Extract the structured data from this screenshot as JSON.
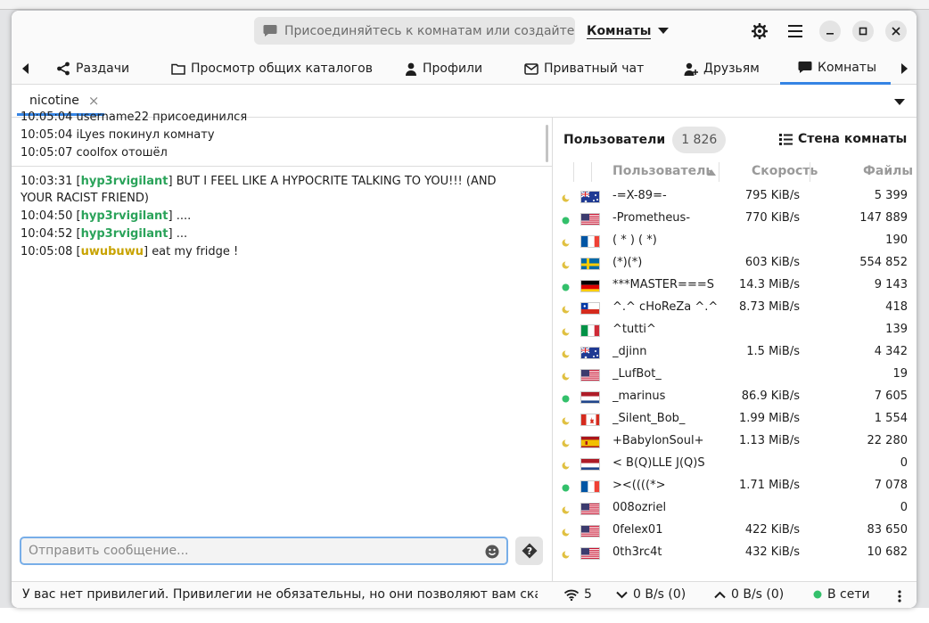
{
  "header": {
    "search_placeholder": "Присоединяйтесь к комнатам или создайте ...",
    "mode_label": "Комнаты"
  },
  "tabs": [
    {
      "label": "Раздачи",
      "icon": "share-icon"
    },
    {
      "label": "Просмотр общих каталогов",
      "icon": "folder-icon"
    },
    {
      "label": "Профили",
      "icon": "user-icon"
    },
    {
      "label": "Приватный чат",
      "icon": "mail-icon"
    },
    {
      "label": "Друзьям",
      "icon": "friends-icon"
    },
    {
      "label": "Комнаты",
      "icon": "chat-icon"
    }
  ],
  "room_tab": {
    "label": "nicotine",
    "close": "×"
  },
  "room_log": [
    "10:05:04 username22 присоединился",
    "10:05:04 iLyes покинул комнату",
    "10:05:07 coolfox отошёл"
  ],
  "chat": [
    {
      "time": "10:03:31",
      "user": "hyp3rvigilant",
      "text": "BUT I FEEL LIKE A HYPOCRITE TALKING TO YOU!!! (AND",
      "text2": "YOUR RACIST FRIEND)",
      "color": "#2aa35a"
    },
    {
      "time": "10:04:50",
      "user": "hyp3rvigilant",
      "text": "....",
      "color": "#2aa35a"
    },
    {
      "time": "10:04:52",
      "user": "hyp3rvigilant",
      "text": "...",
      "color": "#2aa35a"
    },
    {
      "time": "10:05:08",
      "user": "uwubuwu",
      "text": "eat my fridge !",
      "color": "#c8a300"
    }
  ],
  "message_placeholder": "Отправить сообщение...",
  "users_panel": {
    "title": "Пользователи",
    "count": "1 826",
    "wall_label": "Стена комнаты",
    "col_user": "Пользователь",
    "col_speed": "Скорость",
    "col_files": "Файлы"
  },
  "users": [
    {
      "status": "away",
      "flag": "au",
      "name": "-=X-89=-",
      "speed": "795 KiB/s",
      "files": "5 399"
    },
    {
      "status": "online",
      "flag": "us",
      "name": "-Prometheus-",
      "speed": "770 KiB/s",
      "files": "147 889"
    },
    {
      "status": "away",
      "flag": "fr",
      "name": "( *  ) (  *)",
      "speed": "",
      "files": "190"
    },
    {
      "status": "away",
      "flag": "se",
      "name": "(*)(*)",
      "speed": "603 KiB/s",
      "files": "554 852"
    },
    {
      "status": "online",
      "flag": "de",
      "name": "***MASTER===S",
      "speed": "14.3 MiB/s",
      "files": "9 143"
    },
    {
      "status": "away",
      "flag": "cl",
      "name": "^.^ cHoReZa ^.^",
      "speed": "8.73 MiB/s",
      "files": "418"
    },
    {
      "status": "away",
      "flag": "it",
      "name": "^tutti^",
      "speed": "",
      "files": "139"
    },
    {
      "status": "away",
      "flag": "au",
      "name": "_djinn",
      "speed": "1.5 MiB/s",
      "files": "4 342"
    },
    {
      "status": "away",
      "flag": "us",
      "name": "_LufBot_",
      "speed": "",
      "files": "19"
    },
    {
      "status": "online",
      "flag": "nl",
      "name": "_marinus",
      "speed": "86.9 KiB/s",
      "files": "7 605"
    },
    {
      "status": "away",
      "flag": "ca",
      "name": "_Silent_Bob_",
      "speed": "1.99 MiB/s",
      "files": "1 554"
    },
    {
      "status": "away",
      "flag": "es",
      "name": "+BabylonSoul+",
      "speed": "1.13 MiB/s",
      "files": "22 280"
    },
    {
      "status": "away",
      "flag": "nl",
      "name": "<  B(Q)LLE  J(Q)S",
      "speed": "",
      "files": "0"
    },
    {
      "status": "online",
      "flag": "fr",
      "name": "><((((*>",
      "speed": "1.71 MiB/s",
      "files": "7 078"
    },
    {
      "status": "away",
      "flag": "us",
      "name": "008ozriel",
      "speed": "",
      "files": "0"
    },
    {
      "status": "away",
      "flag": "us",
      "name": "0felex01",
      "speed": "422 KiB/s",
      "files": "83 650"
    },
    {
      "status": "away",
      "flag": "us",
      "name": "0th3rc4t",
      "speed": "432 KiB/s",
      "files": "10 682"
    }
  ],
  "statusbar": {
    "message": "У вас нет привилегий. Привилегии не обязательны, но они позволяют вам скач...",
    "connections": "5",
    "download": "0 B/s (0)",
    "upload": "0 B/s (0)",
    "status": "В сети"
  },
  "colors": {
    "accent": "#3584e4",
    "online": "#33c06b",
    "away": "#e0c040",
    "user_green": "#2aa35a",
    "user_yellow": "#c8a300"
  }
}
